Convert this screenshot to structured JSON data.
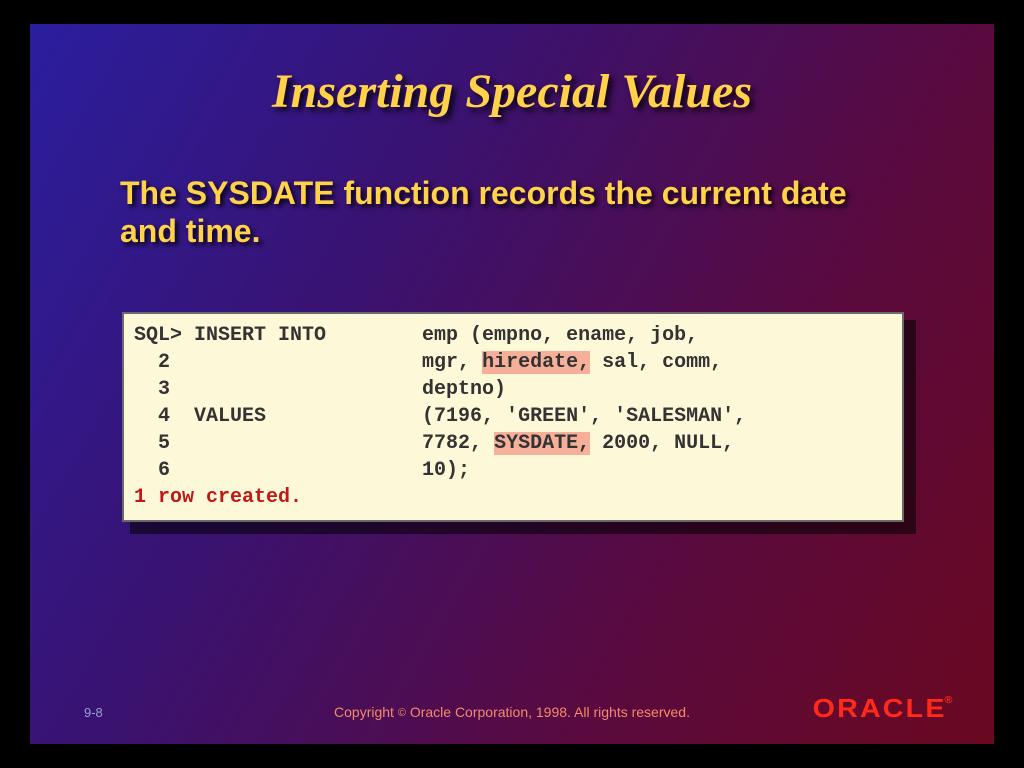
{
  "title": "Inserting Special Values",
  "subtitle": "The SYSDATE function records the current date and time.",
  "code": {
    "l1a": "SQL> INSERT INTO\temp (empno, ename, job,",
    "l2a": "  2             \tmgr, ",
    "l2h": "hiredate,",
    "l2b": " sal, comm,",
    "l3": "  3             \tdeptno)",
    "l4": "  4  VALUES     \t(7196, 'GREEN', 'SALESMAN',",
    "l5a": "  5             \t7782, ",
    "l5h": "SYSDATE,",
    "l5b": " 2000, NULL,",
    "l6": "  6             \t10);",
    "result": "1 row created."
  },
  "footer": {
    "page": "9-8",
    "copyright_pre": "Copyright ",
    "copyright_sym": "©",
    "copyright_post": " Oracle Corporation, 1998. All rights reserved.",
    "logo": "ORACLE",
    "reg": "®"
  }
}
